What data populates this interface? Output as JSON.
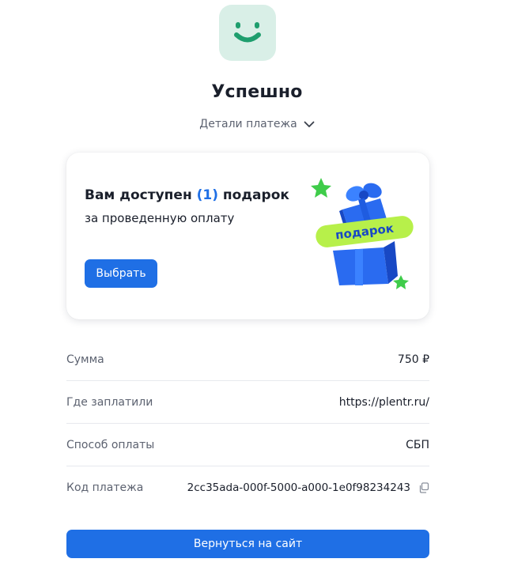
{
  "header": {
    "logo_icon": "smile-icon",
    "title": "Успешно",
    "details_label": "Детали платежа",
    "details_icon": "chevron-down-icon"
  },
  "gift": {
    "title_prefix": "Вам доступен ",
    "count": "(1)",
    "title_suffix": " подарок",
    "subtitle": "за проведенную оплату",
    "choose_label": "Выбрать",
    "badge": "подарок",
    "icon": "gift-box-icon"
  },
  "details": {
    "rows": [
      {
        "label": "Сумма",
        "value": "750 ₽"
      },
      {
        "label": "Где заплатили",
        "value": "https://plentr.ru/"
      },
      {
        "label": "Способ оплаты",
        "value": "СБП"
      },
      {
        "label": "Код платежа",
        "value": "2cc35ada-000f-5000-a000-1e0f98234243"
      }
    ],
    "copy_icon": "copy-icon"
  },
  "return_label": "Вернуться на сайт",
  "colors": {
    "accent": "#1f6fe5",
    "logo_bg": "#d9efe7",
    "logo_fg": "#1e9e6e",
    "text": "#1a1f2b",
    "muted": "#5c6270"
  }
}
